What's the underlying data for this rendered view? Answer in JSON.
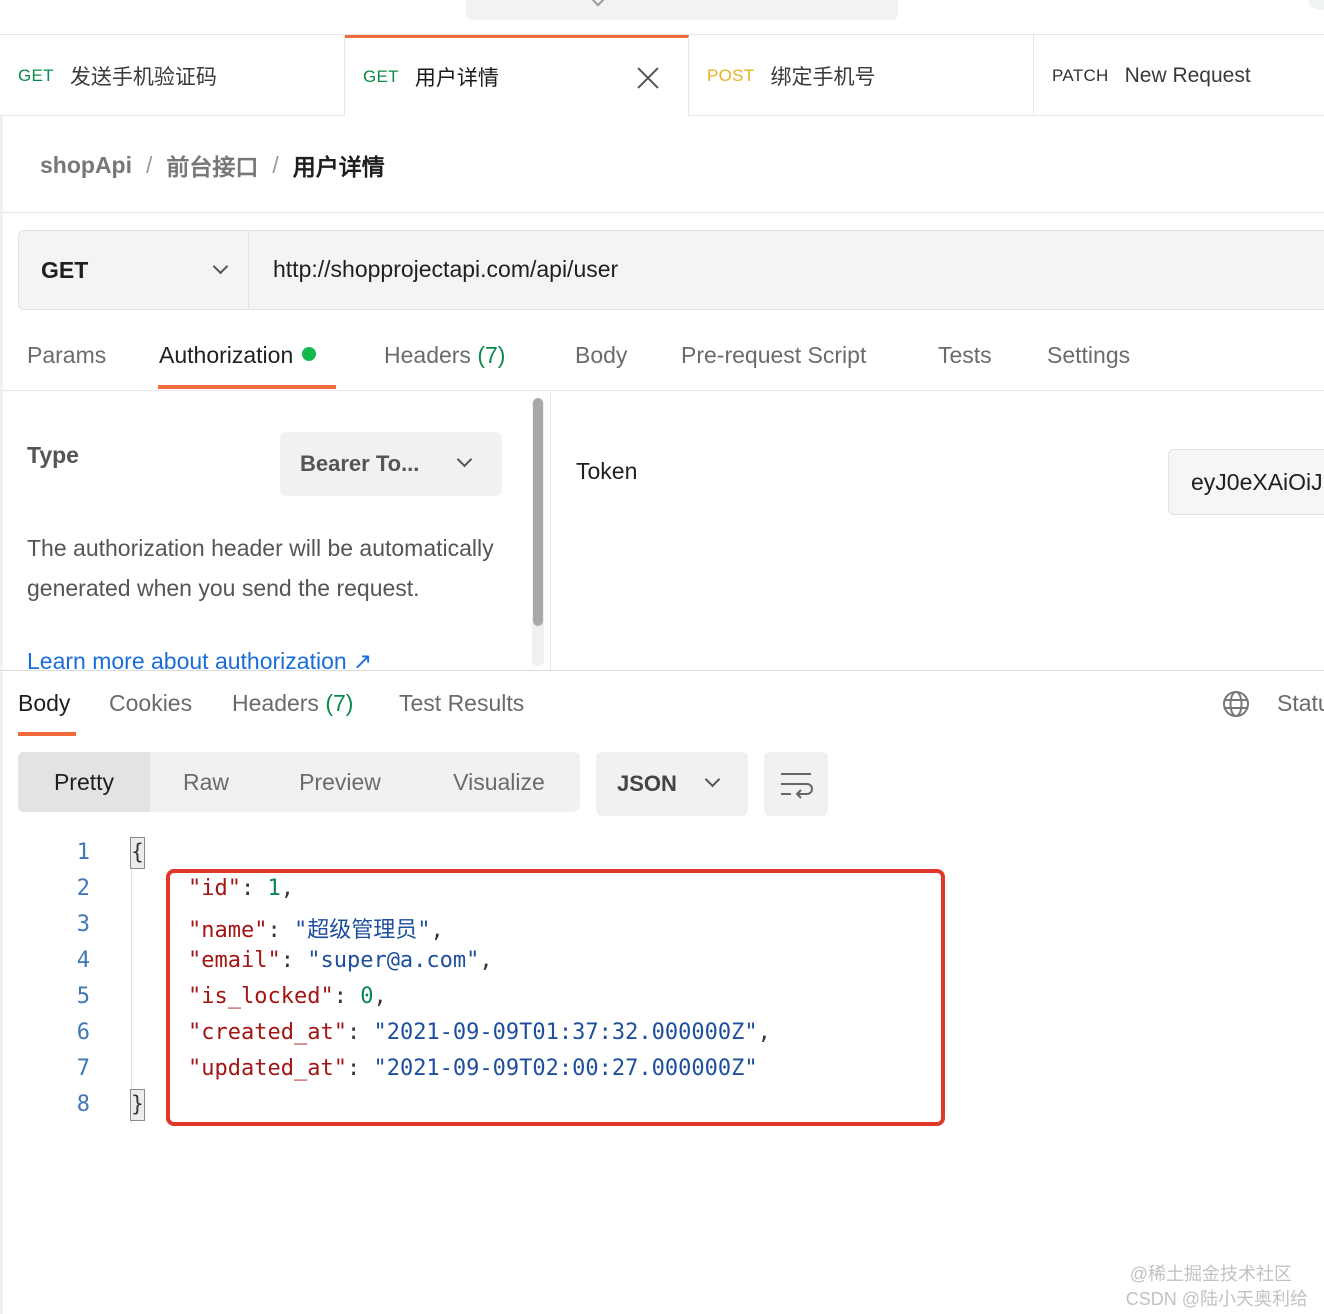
{
  "tabs": [
    {
      "method": "GET",
      "name": "发送手机验证码"
    },
    {
      "method": "GET",
      "name": "用户详情"
    },
    {
      "method": "POST",
      "name": "绑定手机号"
    },
    {
      "method": "PATCH",
      "name": "New Request"
    }
  ],
  "breadcrumb": {
    "collection": "shopApi",
    "sep1": "/",
    "folder": "前台接口",
    "sep2": "/",
    "current": "用户详情"
  },
  "request": {
    "method": "GET",
    "url": "http://shopprojectapi.com/api/user"
  },
  "request_tabs": {
    "params": "Params",
    "authorization": "Authorization",
    "headers": "Headers",
    "headers_count": "(7)",
    "body": "Body",
    "prerequest": "Pre-request Script",
    "tests": "Tests",
    "settings": "Settings"
  },
  "auth": {
    "type_label": "Type",
    "type_value": "Bearer To...",
    "description": "The authorization header will be automatically generated when you send the request.",
    "learn_more": "Learn more about authorization ↗",
    "token_label": "Token",
    "token_value": "eyJ0eXAiOiJ"
  },
  "response_tabs": {
    "body": "Body",
    "cookies": "Cookies",
    "headers": "Headers",
    "headers_count": "(7)",
    "test_results": "Test Results",
    "status": "Statu"
  },
  "view_modes": {
    "pretty": "Pretty",
    "raw": "Raw",
    "preview": "Preview",
    "visualize": "Visualize"
  },
  "format": "JSON",
  "code": {
    "line_numbers": [
      "1",
      "2",
      "3",
      "4",
      "5",
      "6",
      "7",
      "8"
    ],
    "open_brace": "{",
    "close_brace": "}",
    "fields": [
      {
        "key": "\"id\"",
        "value": "1",
        "kind": "number",
        "comma": ","
      },
      {
        "key": "\"name\"",
        "value": "\"超级管理员\"",
        "kind": "string",
        "comma": ","
      },
      {
        "key": "\"email\"",
        "value": "\"super@a.com\"",
        "kind": "string",
        "comma": ","
      },
      {
        "key": "\"is_locked\"",
        "value": "0",
        "kind": "number",
        "comma": ","
      },
      {
        "key": "\"created_at\"",
        "value": "\"2021-09-09T01:37:32.000000Z\"",
        "kind": "string",
        "comma": ","
      },
      {
        "key": "\"updated_at\"",
        "value": "\"2021-09-09T02:00:27.000000Z\"",
        "kind": "string",
        "comma": ""
      }
    ]
  },
  "watermark": {
    "line1": "@稀土掘金技术社区",
    "line2": "CSDN @陆小天奥利给"
  },
  "colors": {
    "accent": "#f26b3a",
    "get": "#0b8a4b",
    "post": "#e6b222",
    "highlight": "#e1372b",
    "auth_dot": "#15b84a"
  },
  "icons": [
    "close-icon",
    "chevron-down-icon",
    "globe-icon",
    "wrap-lines-icon",
    "external-link-icon"
  ]
}
